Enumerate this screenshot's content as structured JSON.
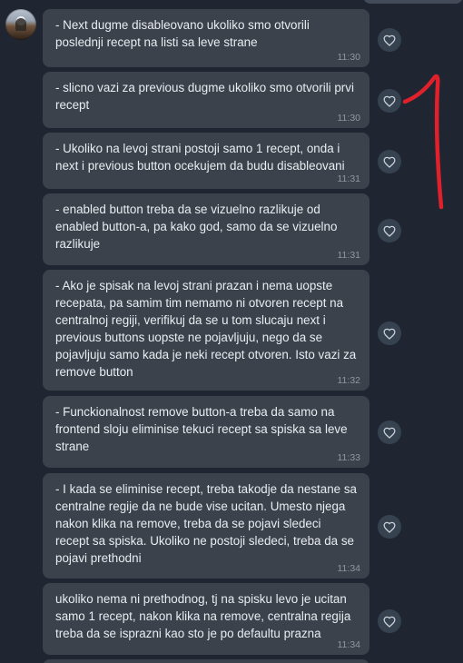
{
  "messages": [
    {
      "text": "- Next dugme disableovano ukoliko smo otvorili poslednji recept na listi sa leve strane",
      "time": "11:30"
    },
    {
      "text": "- slicno vazi za previous dugme ukoliko smo otvorili prvi recept",
      "time": "11:30"
    },
    {
      "text": "- Ukoliko na levoj strani postoji samo 1 recept, onda i next i previous button ocekujem da budu disableovani",
      "time": "11:31"
    },
    {
      "text": "- enabled button treba da se vizuelno razlikuje od enabled button-a, pa kako god, samo da se vizuelno razlikuje",
      "time": "11:31"
    },
    {
      "text": "- Ako je spisak na levoj strani prazan i nema uopste recepata, pa samim tim nemamo ni otvoren recept na centralnoj regiji, verifikuj da se u tom slucaju next i previous buttons uopste ne pojavljuju, nego da se pojavljuju samo kada je neki recept otvoren. Isto vazi za remove button",
      "time": "11:32"
    },
    {
      "text": "- Funckionalnost remove button-a treba da samo na frontend sloju eliminise tekuci recept sa spiska sa leve strane",
      "time": "11:33"
    },
    {
      "text": "- I kada se eliminise recept, treba takodje da nestane sa centralne regije da ne bude vise ucitan. Umesto njega nakon klika na remove, treba da se pojavi sledeci recept sa spiska. Ukoliko ne postoji sledeci, treba da se pojavi prethodni",
      "time": "11:34"
    },
    {
      "text": "ukoliko nema ni prethodnog, tj na spisku levo je ucitan samo 1 recept, nakon klika na remove, centralna regija treba da se isprazni kao sto je po defaultu prazna",
      "time": "11:34"
    }
  ],
  "icons": {
    "reaction": "heart-icon",
    "annotation": "red-freehand-mark"
  },
  "colors": {
    "background": "#1f2631",
    "bubble": "#3b424c",
    "text": "#e9edf2",
    "timestamp": "#8f97a1",
    "annotation": "#e0212b"
  }
}
